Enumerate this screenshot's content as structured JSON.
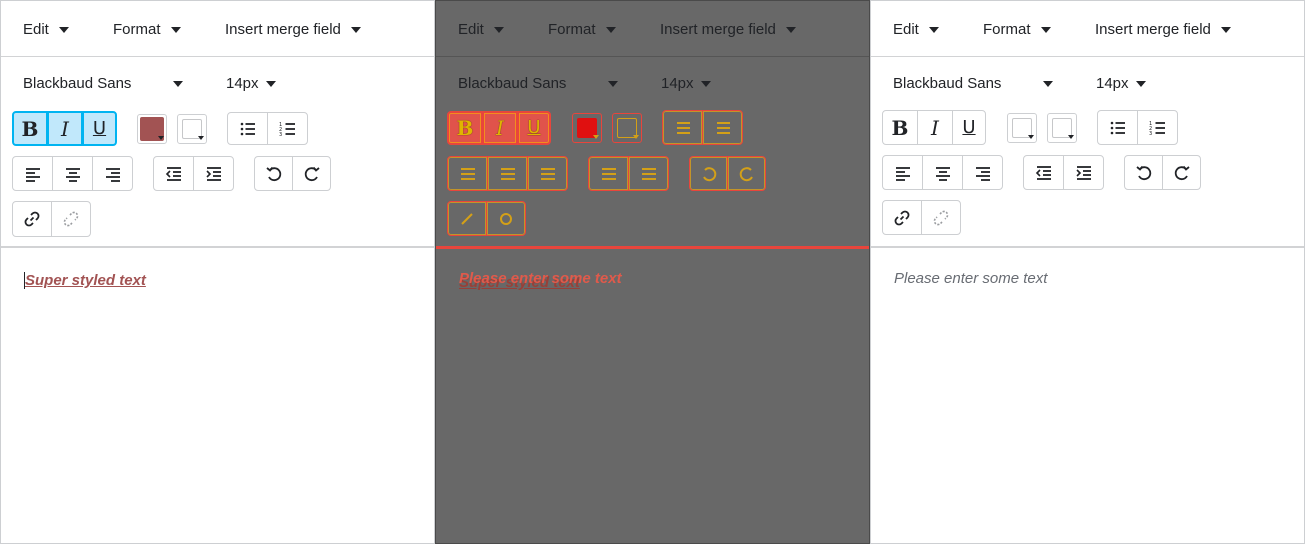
{
  "menubar": {
    "edit": "Edit",
    "format": "Format",
    "insert_merge_field": "Insert merge field"
  },
  "font": {
    "family": "Blackbaud Sans",
    "size": "14px"
  },
  "format_buttons": {
    "bold": "B",
    "italic": "I",
    "underline": "U"
  },
  "icons": [
    "bold-icon",
    "italic-icon",
    "underline-icon",
    "font-color-icon",
    "highlight-color-icon",
    "bulleted-list-icon",
    "numbered-list-icon",
    "align-left-icon",
    "align-center-icon",
    "align-right-icon",
    "outdent-icon",
    "indent-icon",
    "undo-icon",
    "redo-icon",
    "link-icon",
    "unlink-icon"
  ],
  "colors": {
    "accent": "#00b4f1",
    "active_bg": "#c1e8fb",
    "text_color_swatch": "#a25353",
    "overlay_bg": "#686868",
    "overlay_red": "#e8453c"
  },
  "panels": {
    "left": {
      "editor_text": "Super styled text",
      "text_color": "#a25353"
    },
    "mid": {
      "placeholder": "Please enter some text",
      "ghost_text": "Super styled text"
    },
    "right": {
      "placeholder": "Please enter some text"
    }
  }
}
